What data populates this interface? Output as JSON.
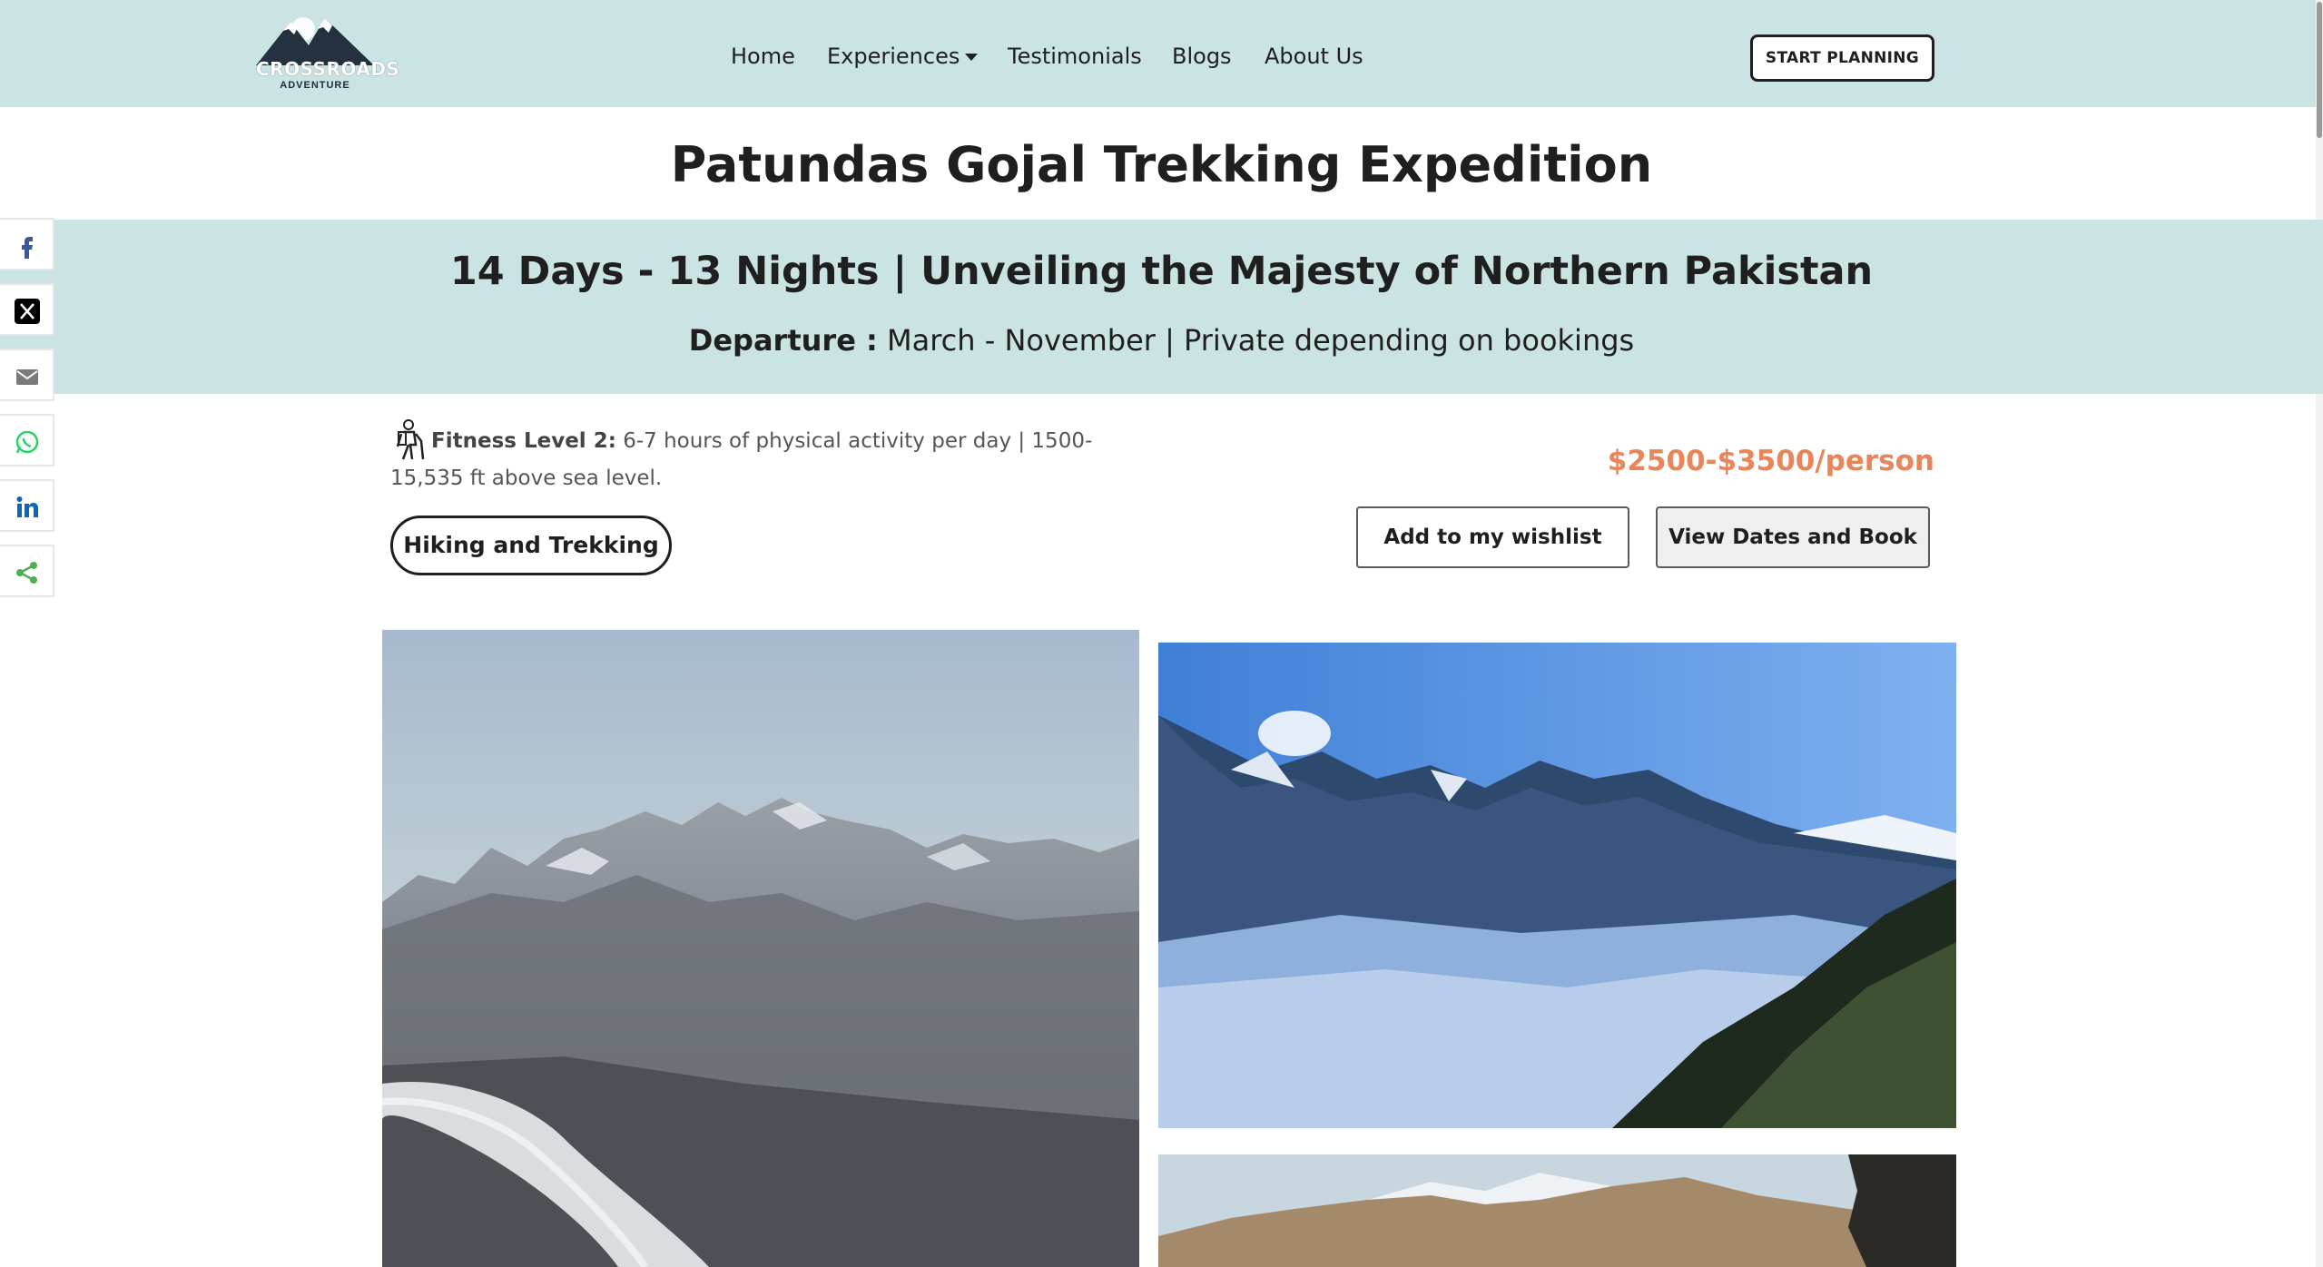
{
  "header": {
    "logo": {
      "name": "CROSSROADS",
      "sub": "ADVENTURE",
      "icon": "mountain-logo"
    },
    "nav": [
      {
        "label": "Home"
      },
      {
        "label": "Experiences",
        "has_dropdown": true
      },
      {
        "label": "Testimonials"
      },
      {
        "label": "Blogs"
      },
      {
        "label": "About Us"
      }
    ],
    "cta_label": "START PLANNING"
  },
  "page_title": "Patundas Gojal Trekking Expedition",
  "band": {
    "subtitle": "14 Days - 13 Nights | Unveiling the Majesty of Northern Pakistan",
    "departure_label": "Departure :",
    "departure_value": "March - November | Private depending on bookings"
  },
  "share": [
    {
      "icon": "facebook-icon",
      "color": "#3b5998"
    },
    {
      "icon": "x-icon",
      "color": "#000000"
    },
    {
      "icon": "email-icon",
      "color": "#7a7a7a"
    },
    {
      "icon": "whatsapp-icon",
      "color": "#25d366"
    },
    {
      "icon": "linkedin-icon",
      "color": "#0a66c2"
    },
    {
      "icon": "share-icon",
      "color": "#4caf50"
    }
  ],
  "details": {
    "fitness_label": "Fitness Level 2:",
    "fitness_text": "6-7 hours of physical activity per day | 1500-15,535 ft above sea level.",
    "tag": "Hiking and Trekking",
    "price": "$2500-$3500/person",
    "wishlist_label": "Add to my wishlist",
    "book_label": "View Dates and Book"
  },
  "colors": {
    "band": "#cae3e3",
    "price": "#e8855a",
    "text": "#1f1f1f"
  }
}
